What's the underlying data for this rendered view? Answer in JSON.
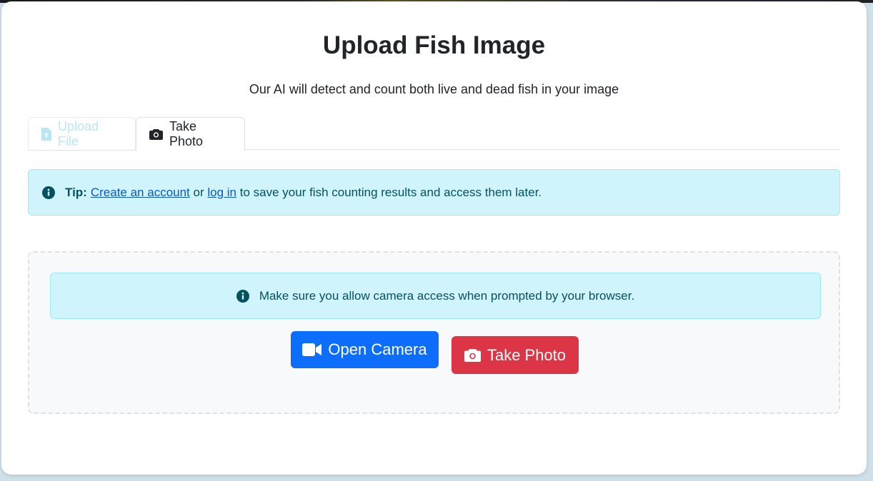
{
  "header": {
    "title": "Upload Fish Image",
    "subtitle": "Our AI will detect and count both live and dead fish in your image"
  },
  "tabs": [
    {
      "label": "Upload File",
      "icon": "file-upload-icon",
      "active": false
    },
    {
      "label": "Take Photo",
      "icon": "camera-icon",
      "active": true
    }
  ],
  "tip_alert": {
    "icon": "info-circle-icon",
    "label": "Tip:",
    "link_create": "Create an account",
    "middle": "or",
    "link_login": "log in",
    "rest": "to save your fish counting results and access them later."
  },
  "camera_panel": {
    "notice_icon": "info-circle-icon",
    "notice": "Make sure you allow camera access when prompted by your browser.",
    "open_camera_label": "Open Camera",
    "open_camera_icon": "video-camera-icon",
    "take_photo_label": "Take Photo",
    "take_photo_icon": "camera-icon"
  },
  "colors": {
    "primary": "#0d6efd",
    "danger": "#dc3545",
    "info_bg": "#cff4fc",
    "info_text": "#055160"
  }
}
